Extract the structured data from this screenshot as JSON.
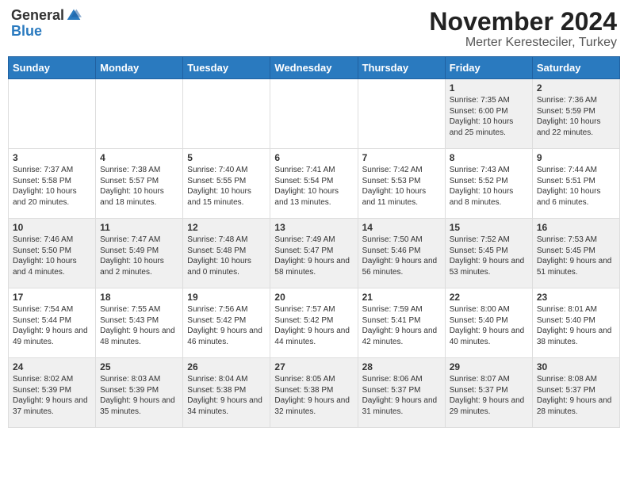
{
  "header": {
    "logo_general": "General",
    "logo_blue": "Blue",
    "month": "November 2024",
    "location": "Merter Keresteciler, Turkey"
  },
  "days_of_week": [
    "Sunday",
    "Monday",
    "Tuesday",
    "Wednesday",
    "Thursday",
    "Friday",
    "Saturday"
  ],
  "weeks": [
    [
      {
        "day": "",
        "info": ""
      },
      {
        "day": "",
        "info": ""
      },
      {
        "day": "",
        "info": ""
      },
      {
        "day": "",
        "info": ""
      },
      {
        "day": "",
        "info": ""
      },
      {
        "day": "1",
        "info": "Sunrise: 7:35 AM\nSunset: 6:00 PM\nDaylight: 10 hours and 25 minutes."
      },
      {
        "day": "2",
        "info": "Sunrise: 7:36 AM\nSunset: 5:59 PM\nDaylight: 10 hours and 22 minutes."
      }
    ],
    [
      {
        "day": "3",
        "info": "Sunrise: 7:37 AM\nSunset: 5:58 PM\nDaylight: 10 hours and 20 minutes."
      },
      {
        "day": "4",
        "info": "Sunrise: 7:38 AM\nSunset: 5:57 PM\nDaylight: 10 hours and 18 minutes."
      },
      {
        "day": "5",
        "info": "Sunrise: 7:40 AM\nSunset: 5:55 PM\nDaylight: 10 hours and 15 minutes."
      },
      {
        "day": "6",
        "info": "Sunrise: 7:41 AM\nSunset: 5:54 PM\nDaylight: 10 hours and 13 minutes."
      },
      {
        "day": "7",
        "info": "Sunrise: 7:42 AM\nSunset: 5:53 PM\nDaylight: 10 hours and 11 minutes."
      },
      {
        "day": "8",
        "info": "Sunrise: 7:43 AM\nSunset: 5:52 PM\nDaylight: 10 hours and 8 minutes."
      },
      {
        "day": "9",
        "info": "Sunrise: 7:44 AM\nSunset: 5:51 PM\nDaylight: 10 hours and 6 minutes."
      }
    ],
    [
      {
        "day": "10",
        "info": "Sunrise: 7:46 AM\nSunset: 5:50 PM\nDaylight: 10 hours and 4 minutes."
      },
      {
        "day": "11",
        "info": "Sunrise: 7:47 AM\nSunset: 5:49 PM\nDaylight: 10 hours and 2 minutes."
      },
      {
        "day": "12",
        "info": "Sunrise: 7:48 AM\nSunset: 5:48 PM\nDaylight: 10 hours and 0 minutes."
      },
      {
        "day": "13",
        "info": "Sunrise: 7:49 AM\nSunset: 5:47 PM\nDaylight: 9 hours and 58 minutes."
      },
      {
        "day": "14",
        "info": "Sunrise: 7:50 AM\nSunset: 5:46 PM\nDaylight: 9 hours and 56 minutes."
      },
      {
        "day": "15",
        "info": "Sunrise: 7:52 AM\nSunset: 5:45 PM\nDaylight: 9 hours and 53 minutes."
      },
      {
        "day": "16",
        "info": "Sunrise: 7:53 AM\nSunset: 5:45 PM\nDaylight: 9 hours and 51 minutes."
      }
    ],
    [
      {
        "day": "17",
        "info": "Sunrise: 7:54 AM\nSunset: 5:44 PM\nDaylight: 9 hours and 49 minutes."
      },
      {
        "day": "18",
        "info": "Sunrise: 7:55 AM\nSunset: 5:43 PM\nDaylight: 9 hours and 48 minutes."
      },
      {
        "day": "19",
        "info": "Sunrise: 7:56 AM\nSunset: 5:42 PM\nDaylight: 9 hours and 46 minutes."
      },
      {
        "day": "20",
        "info": "Sunrise: 7:57 AM\nSunset: 5:42 PM\nDaylight: 9 hours and 44 minutes."
      },
      {
        "day": "21",
        "info": "Sunrise: 7:59 AM\nSunset: 5:41 PM\nDaylight: 9 hours and 42 minutes."
      },
      {
        "day": "22",
        "info": "Sunrise: 8:00 AM\nSunset: 5:40 PM\nDaylight: 9 hours and 40 minutes."
      },
      {
        "day": "23",
        "info": "Sunrise: 8:01 AM\nSunset: 5:40 PM\nDaylight: 9 hours and 38 minutes."
      }
    ],
    [
      {
        "day": "24",
        "info": "Sunrise: 8:02 AM\nSunset: 5:39 PM\nDaylight: 9 hours and 37 minutes."
      },
      {
        "day": "25",
        "info": "Sunrise: 8:03 AM\nSunset: 5:39 PM\nDaylight: 9 hours and 35 minutes."
      },
      {
        "day": "26",
        "info": "Sunrise: 8:04 AM\nSunset: 5:38 PM\nDaylight: 9 hours and 34 minutes."
      },
      {
        "day": "27",
        "info": "Sunrise: 8:05 AM\nSunset: 5:38 PM\nDaylight: 9 hours and 32 minutes."
      },
      {
        "day": "28",
        "info": "Sunrise: 8:06 AM\nSunset: 5:37 PM\nDaylight: 9 hours and 31 minutes."
      },
      {
        "day": "29",
        "info": "Sunrise: 8:07 AM\nSunset: 5:37 PM\nDaylight: 9 hours and 29 minutes."
      },
      {
        "day": "30",
        "info": "Sunrise: 8:08 AM\nSunset: 5:37 PM\nDaylight: 9 hours and 28 minutes."
      }
    ]
  ]
}
